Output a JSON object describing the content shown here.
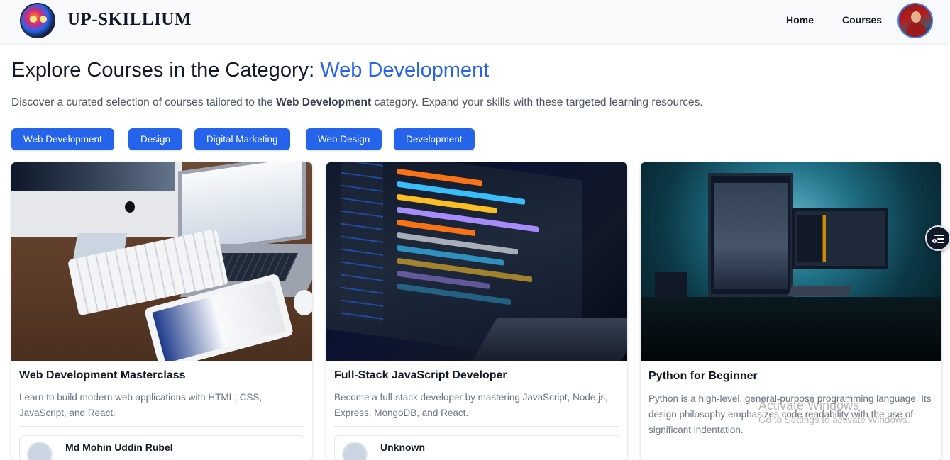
{
  "navbar": {
    "brand": "UP-SKILLIUM",
    "links": [
      "Home",
      "Courses"
    ]
  },
  "heading": {
    "prefix": "Explore Courses in the Category: ",
    "category": "Web Development"
  },
  "description": {
    "before": "Discover a curated selection of courses tailored to the ",
    "bold": "Web Development",
    "after": " category. Expand your skills with these targeted learning resources."
  },
  "categories": [
    "Web Development",
    "Design",
    "Digital Marketing",
    "Web Design",
    "Development"
  ],
  "courses": [
    {
      "title": "Web Development Masterclass",
      "description": "Learn to build modern web applications with HTML, CSS, JavaScript, and React.",
      "instructor": "Md Mohin Uddin Rubel"
    },
    {
      "title": "Full-Stack JavaScript Developer",
      "description": "Become a full-stack developer by mastering JavaScript, Node.js, Express, MongoDB, and React.",
      "instructor": "Unknown"
    },
    {
      "title": "Python for Beginner",
      "description": "Python is a high-level, general-purpose programming language. Its design philosophy emphasizes code readability with the use of significant indentation.",
      "instructor": ""
    }
  ],
  "watermark": {
    "line1": "Activate Windows",
    "line2": "Go to Settings to activate Windows."
  },
  "colors": {
    "accent": "#2563eb"
  }
}
